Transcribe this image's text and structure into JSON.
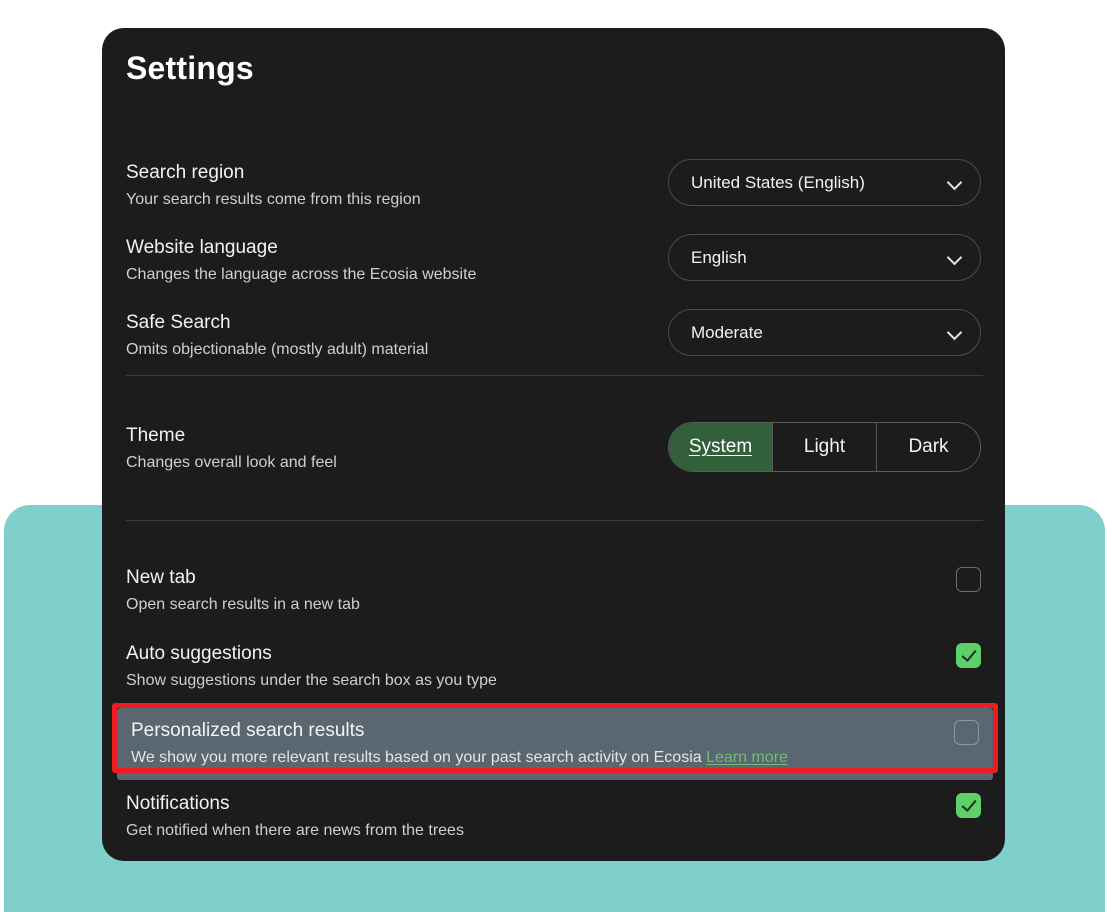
{
  "page": {
    "title": "Settings",
    "card_bg": "#1c1c1c",
    "backdrop_color": "#7fcfcb",
    "accent_green": "#5ed06a",
    "selected_segment_green": "#31603a",
    "highlight_border": "#ed1c24",
    "highlight_row_bg": "#5a6670",
    "link_color": "#6fbf73"
  },
  "settings": {
    "search_region": {
      "title": "Search region",
      "description": "Your search results come from this region",
      "control": "select",
      "value": "United States (English)"
    },
    "website_language": {
      "title": "Website language",
      "description": "Changes the language across the Ecosia website",
      "control": "select",
      "value": "English"
    },
    "safe_search": {
      "title": "Safe Search",
      "description": "Omits objectionable (mostly adult) material",
      "control": "select",
      "value": "Moderate"
    },
    "theme": {
      "title": "Theme",
      "description": "Changes overall look and feel",
      "control": "segmented",
      "options": [
        "System",
        "Light",
        "Dark"
      ],
      "selected": "System"
    },
    "new_tab": {
      "title": "New tab",
      "description": "Open search results in a new tab",
      "control": "checkbox",
      "checked": false
    },
    "auto_suggestions": {
      "title": "Auto suggestions",
      "description": "Show suggestions under the search box as you type",
      "control": "checkbox",
      "checked": true
    },
    "personalized_search_results": {
      "title": "Personalized search results",
      "description": "We show you more relevant results based on your past search activity on Ecosia ",
      "link_label": "Learn more",
      "control": "checkbox",
      "checked": false,
      "highlighted": true
    },
    "notifications": {
      "title": "Notifications",
      "description": "Get notified when there are news from the trees",
      "control": "checkbox",
      "checked": true
    }
  },
  "icons": {
    "chevron_down": "chevron-down-icon",
    "checkmark": "checkmark-icon"
  }
}
